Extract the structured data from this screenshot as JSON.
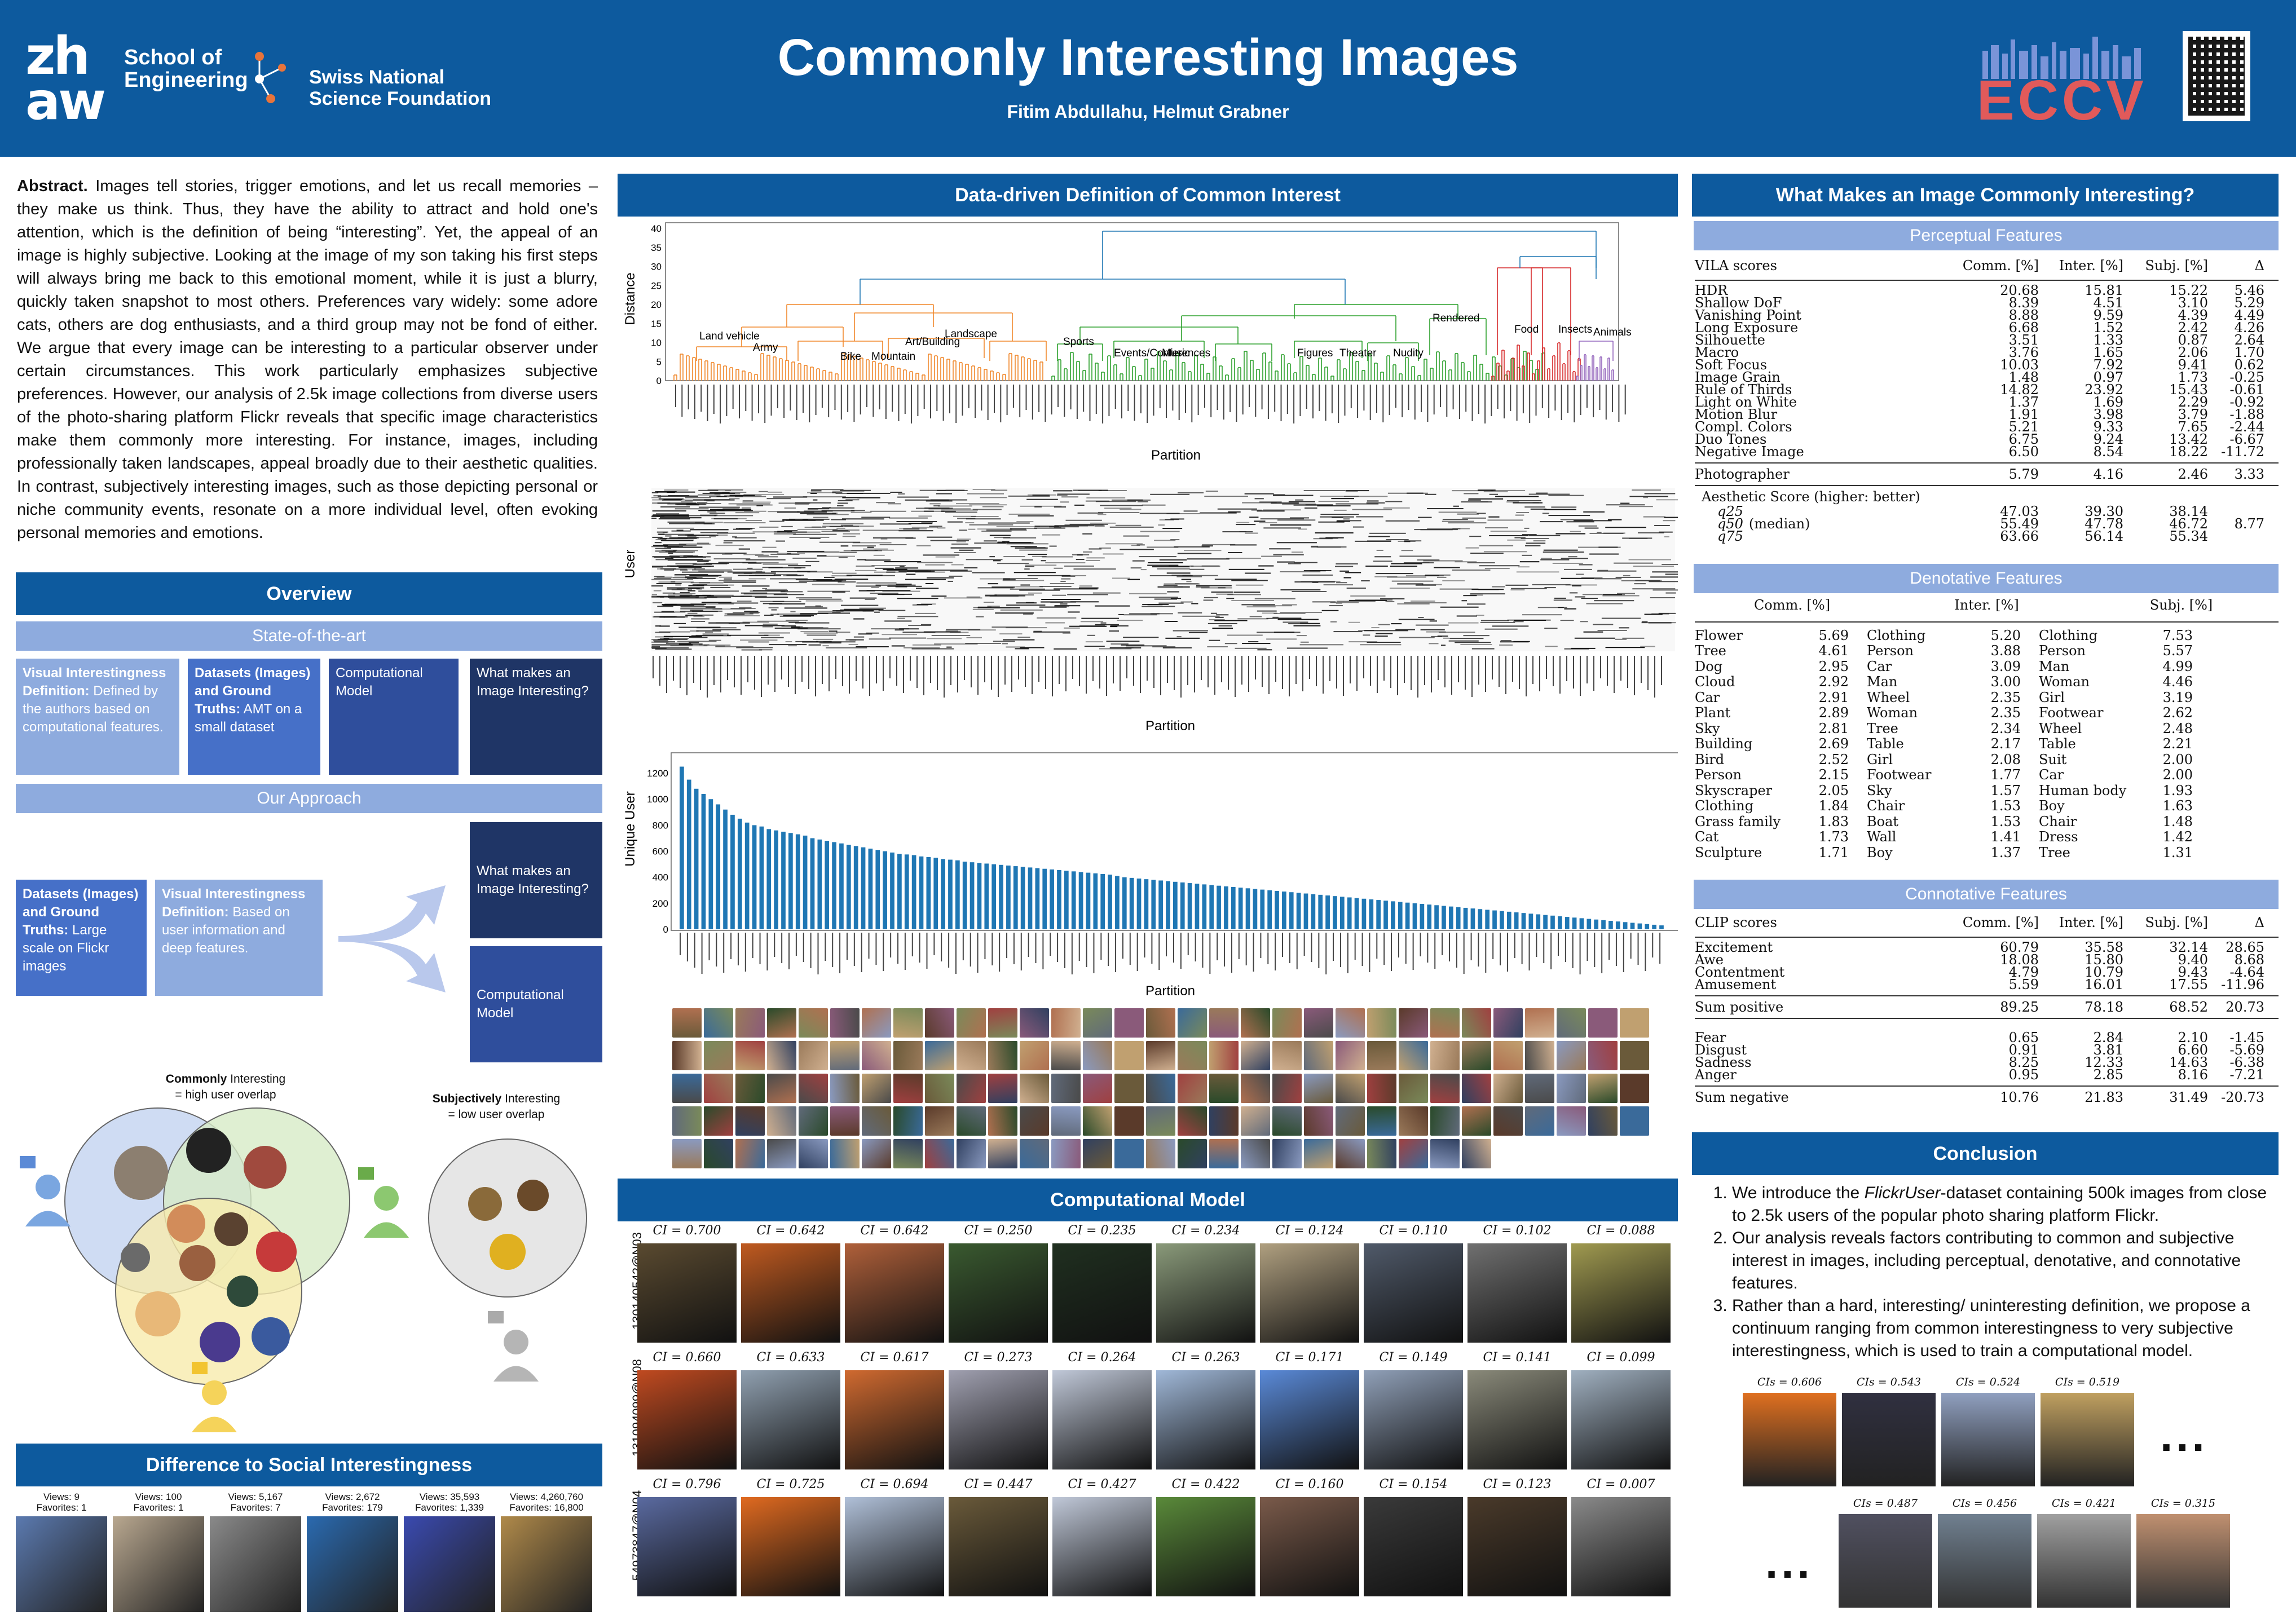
{
  "header": {
    "logo_zh": "zh",
    "logo_aw": "aw",
    "school": "School of Engineering",
    "school_line1": "School of",
    "school_line2": "Engineering",
    "snsf_line1": "Swiss National",
    "snsf_line2": "Science Foundation",
    "title": "Commonly Interesting Images",
    "authors": "Fitim Abdullahu, Helmut Grabner",
    "eccv": "ECCV"
  },
  "abstract": {
    "label": "Abstract.",
    "text": "Images tell stories, trigger emotions, and let us recall memories – they make us think. Thus, they have the ability to attract and hold one's attention, which is the definition of being “interesting”. Yet, the appeal of an image is highly subjective. Looking at the image of my son taking his first steps will always bring me back to this emotional moment, while it is just a blurry, quickly taken snapshot to most others. Preferences vary widely: some adore cats, others are dog enthusiasts, and a third group may not be fond of either. We argue that every image can be interesting to a particular observer under certain circumstances. This work particularly emphasizes subjective preferences. However, our analysis of 2.5k image collections from diverse users of the photo-sharing platform Flickr reveals that specific image characteristics make them commonly more interesting. For instance, images, including professionally taken landscapes, appeal broadly due to their aesthetic qualities. In contrast, subjectively interesting images, such as those depicting personal or niche community events, resonate on a more individual level, often evoking personal memories and emotions."
  },
  "overview": {
    "title": "Overview",
    "sota": "State-of-the-art",
    "sota_boxes": [
      {
        "bold": "Visual Interestingness Definition:",
        "rest": " Defined by the authors based on computational features."
      },
      {
        "bold": "Datasets (Images) and Ground Truths:",
        "rest": " AMT on a small dataset"
      },
      {
        "bold": "",
        "rest": "Computational Model"
      },
      {
        "bold": "",
        "rest": "What makes an Image Interesting?"
      }
    ],
    "approach": "Our Approach",
    "approach_boxes": [
      {
        "bold": "Datasets (Images) and Ground Truths:",
        "rest": " Large scale on Flickr images"
      },
      {
        "bold": "Visual Interestingness Definition:",
        "rest": " Based on user information and deep features."
      },
      {
        "bold": "",
        "rest": "What makes an Image Interesting?"
      },
      {
        "bold": "",
        "rest": "Computational Model"
      }
    ],
    "commonly_bold": "Commonly",
    "commonly_rest": " Interesting",
    "commonly_sub": "= high user overlap",
    "subj_bold": "Subjectively",
    "subj_rest": " Interesting",
    "subj_sub": "= low user overlap"
  },
  "social": {
    "title": "Difference to Social Interestingness",
    "items": [
      {
        "views": "Views: 9",
        "fav": "Favorites: 1"
      },
      {
        "views": "Views: 100",
        "fav": "Favorites: 1"
      },
      {
        "views": "Views: 5,167",
        "fav": "Favorites: 7"
      },
      {
        "views": "Views: 2,672",
        "fav": "Favorites: 179"
      },
      {
        "views": "Views: 35,593",
        "fav": "Favorites: 1,339"
      },
      {
        "views": "Views: 4,260,760",
        "fav": "Favorites: 16,800"
      }
    ]
  },
  "datadriven": {
    "title": "Data-driven Definition of Common Interest",
    "dendro_ylabel": "Distance",
    "dendro_xlabel": "Partition",
    "dendro_yticks": [
      "0",
      "5",
      "10",
      "15",
      "20",
      "25",
      "30",
      "35",
      "40"
    ],
    "clusters": [
      "Land vehicle",
      "Army",
      "Bike",
      "Mountain",
      "Art/Building",
      "Landscape",
      "Sports",
      "Events/Conferences",
      "Music",
      "Figures",
      "Theater",
      "Nudity",
      "Rendered",
      "Food",
      "Insects",
      "Animals"
    ],
    "user_ylabel": "User",
    "user_xlabel": "Partition",
    "bar_ylabel": "Unique User",
    "bar_xlabel": "Partition",
    "bar_yticks": [
      "0",
      "200",
      "400",
      "600",
      "800",
      "1000",
      "1200"
    ]
  },
  "chart_data": {
    "type": "bar",
    "title": "",
    "xlabel": "Partition",
    "ylabel": "Unique User",
    "ylim": [
      0,
      1300
    ],
    "values": [
      1250,
      1150,
      1080,
      1040,
      1000,
      960,
      920,
      880,
      850,
      820,
      800,
      790,
      770,
      760,
      750,
      740,
      730,
      720,
      700,
      690,
      680,
      670,
      660,
      650,
      640,
      630,
      620,
      610,
      600,
      590,
      580,
      575,
      570,
      560,
      555,
      550,
      540,
      535,
      530,
      520,
      515,
      510,
      505,
      500,
      495,
      490,
      485,
      480,
      475,
      470,
      465,
      460,
      455,
      450,
      445,
      440,
      435,
      430,
      425,
      420,
      410,
      400,
      395,
      390,
      385,
      380,
      375,
      370,
      365,
      360,
      355,
      350,
      345,
      340,
      335,
      330,
      325,
      320,
      315,
      310,
      305,
      300,
      295,
      290,
      285,
      280,
      275,
      270,
      265,
      260,
      255,
      250,
      245,
      240,
      235,
      230,
      225,
      220,
      215,
      210,
      205,
      200,
      195,
      190,
      185,
      180,
      175,
      170,
      165,
      160,
      155,
      150,
      145,
      140,
      135,
      130,
      125,
      120,
      115,
      110,
      105,
      100,
      95,
      90,
      85,
      80,
      75,
      70,
      65,
      60,
      55,
      50,
      45,
      40,
      35,
      30
    ]
  },
  "compmodel": {
    "title": "Computational Model",
    "rows": [
      {
        "user": "130140542@N03",
        "ci": [
          "CI = 0.700",
          "CI = 0.642",
          "CI = 0.642",
          "CI = 0.250",
          "CI = 0.235",
          "CI = 0.234",
          "CI = 0.124",
          "CI = 0.110",
          "CI = 0.102",
          "CI = 0.088"
        ]
      },
      {
        "user": "131094099@N08",
        "ci": [
          "CI = 0.660",
          "CI = 0.633",
          "CI = 0.617",
          "CI = 0.273",
          "CI = 0.264",
          "CI = 0.263",
          "CI = 0.171",
          "CI = 0.149",
          "CI = 0.141",
          "CI = 0.099"
        ]
      },
      {
        "user": "54973847@N04",
        "ci": [
          "CI = 0.796",
          "CI = 0.725",
          "CI = 0.694",
          "CI = 0.447",
          "CI = 0.427",
          "CI = 0.422",
          "CI = 0.160",
          "CI = 0.154",
          "CI = 0.123",
          "CI = 0.007"
        ]
      }
    ]
  },
  "what": {
    "title": "What Makes an Image Commonly Interesting?",
    "perceptual": "Perceptual Features",
    "vila_header": [
      "VILA scores",
      "Comm. [%]",
      "Inter. [%]",
      "Subj. [%]",
      "Δ"
    ],
    "vila_rows": [
      [
        "HDR",
        "20.68",
        "15.81",
        "15.22",
        "5.46"
      ],
      [
        "Shallow DoF",
        "8.39",
        "4.51",
        "3.10",
        "5.29"
      ],
      [
        "Vanishing Point",
        "8.88",
        "9.59",
        "4.39",
        "4.49"
      ],
      [
        "Long Exposure",
        "6.68",
        "1.52",
        "2.42",
        "4.26"
      ],
      [
        "Silhouette",
        "3.51",
        "1.33",
        "0.87",
        "2.64"
      ],
      [
        "Macro",
        "3.76",
        "1.65",
        "2.06",
        "1.70"
      ],
      [
        "Soft Focus",
        "10.03",
        "7.92",
        "9.41",
        "0.62"
      ],
      [
        "Image Grain",
        "1.48",
        "0.97",
        "1.73",
        "-0.25"
      ],
      [
        "Rule of Thirds",
        "14.82",
        "23.92",
        "15.43",
        "-0.61"
      ],
      [
        "Light on White",
        "1.37",
        "1.69",
        "2.29",
        "-0.92"
      ],
      [
        "Motion Blur",
        "1.91",
        "3.98",
        "3.79",
        "-1.88"
      ],
      [
        "Compl. Colors",
        "5.21",
        "9.33",
        "7.65",
        "-2.44"
      ],
      [
        "Duo Tones",
        "6.75",
        "9.24",
        "13.42",
        "-6.67"
      ],
      [
        "Negative Image",
        "6.50",
        "8.54",
        "18.22",
        "-11.72"
      ]
    ],
    "photographer": [
      "Photographer",
      "5.79",
      "4.16",
      "2.46",
      "3.33"
    ],
    "aesthetic_label": "Aesthetic Score (higher: better)",
    "aesthetic_rows": [
      [
        "q25",
        "",
        "47.03",
        "39.30",
        "38.14"
      ],
      [
        "q50",
        "(median)",
        "55.49",
        "47.78",
        "46.72"
      ],
      [
        "q75",
        "",
        "63.66",
        "56.14",
        "55.34"
      ]
    ],
    "aesthetic_delta": "8.77",
    "denotative": "Denotative Features",
    "den_header": [
      "Comm. [%]",
      "Inter. [%]",
      "Subj. [%]"
    ],
    "den_comm": [
      [
        "Flower",
        "5.69"
      ],
      [
        "Tree",
        "4.61"
      ],
      [
        "Dog",
        "2.95"
      ],
      [
        "Cloud",
        "2.92"
      ],
      [
        "Car",
        "2.91"
      ],
      [
        "Plant",
        "2.89"
      ],
      [
        "Sky",
        "2.81"
      ],
      [
        "Building",
        "2.69"
      ],
      [
        "Bird",
        "2.52"
      ],
      [
        "Person",
        "2.15"
      ],
      [
        "Skyscraper",
        "2.05"
      ],
      [
        "Clothing",
        "1.84"
      ],
      [
        "Grass family",
        "1.83"
      ],
      [
        "Cat",
        "1.73"
      ],
      [
        "Sculpture",
        "1.71"
      ]
    ],
    "den_inter": [
      [
        "Clothing",
        "5.20"
      ],
      [
        "Person",
        "3.88"
      ],
      [
        "Car",
        "3.09"
      ],
      [
        "Man",
        "3.00"
      ],
      [
        "Wheel",
        "2.35"
      ],
      [
        "Woman",
        "2.35"
      ],
      [
        "Tree",
        "2.34"
      ],
      [
        "Table",
        "2.17"
      ],
      [
        "Girl",
        "2.08"
      ],
      [
        "Footwear",
        "1.77"
      ],
      [
        "Sky",
        "1.57"
      ],
      [
        "Chair",
        "1.53"
      ],
      [
        "Boat",
        "1.53"
      ],
      [
        "Wall",
        "1.41"
      ],
      [
        "Boy",
        "1.37"
      ]
    ],
    "den_subj": [
      [
        "Clothing",
        "7.53"
      ],
      [
        "Person",
        "5.57"
      ],
      [
        "Man",
        "4.99"
      ],
      [
        "Woman",
        "4.46"
      ],
      [
        "Girl",
        "3.19"
      ],
      [
        "Footwear",
        "2.62"
      ],
      [
        "Wheel",
        "2.48"
      ],
      [
        "Table",
        "2.21"
      ],
      [
        "Suit",
        "2.00"
      ],
      [
        "Car",
        "2.00"
      ],
      [
        "Human body",
        "1.93"
      ],
      [
        "Boy",
        "1.63"
      ],
      [
        "Chair",
        "1.48"
      ],
      [
        "Dress",
        "1.42"
      ],
      [
        "Tree",
        "1.31"
      ]
    ],
    "connotative": "Connotative Features",
    "clip_header": [
      "CLIP scores",
      "Comm. [%]",
      "Inter. [%]",
      "Subj. [%]",
      "Δ"
    ],
    "clip_pos": [
      [
        "Excitement",
        "60.79",
        "35.58",
        "32.14",
        "28.65"
      ],
      [
        "Awe",
        "18.08",
        "15.80",
        "9.40",
        "8.68"
      ],
      [
        "Contentment",
        "4.79",
        "10.79",
        "9.43",
        "-4.64"
      ],
      [
        "Amusement",
        "5.59",
        "16.01",
        "17.55",
        "-11.96"
      ]
    ],
    "sum_pos": [
      "Sum positive",
      "89.25",
      "78.18",
      "68.52",
      "20.73"
    ],
    "clip_neg": [
      [
        "Fear",
        "0.65",
        "2.84",
        "2.10",
        "-1.45"
      ],
      [
        "Disgust",
        "0.91",
        "3.81",
        "6.60",
        "-5.69"
      ],
      [
        "Sadness",
        "8.25",
        "12.33",
        "14.63",
        "-6.38"
      ],
      [
        "Anger",
        "0.95",
        "2.85",
        "8.16",
        "-7.21"
      ]
    ],
    "sum_neg": [
      "Sum negative",
      "10.76",
      "21.83",
      "31.49",
      "-20.73"
    ]
  },
  "conclusion": {
    "title": "Conclusion",
    "items": [
      {
        "pre": "We introduce the ",
        "em": "FlickrUser",
        "post": "-dataset containing 500k images from close to 2.5k users of the popular photo sharing platform Flickr."
      },
      {
        "pre": "Our analysis reveals factors contributing to common and subjective interest in images, including perceptual, denotative, and connotative features.",
        "em": "",
        "post": ""
      },
      {
        "pre": "Rather than a hard, interesting/ uninteresting definition, we propose a continuum ranging from common interestingness to very subjective interestingness, which is used to train a computational model.",
        "em": "",
        "post": ""
      }
    ],
    "row1": [
      "CIs = 0.606",
      "CIs = 0.543",
      "CIs = 0.524",
      "CIs = 0.519"
    ],
    "row2": [
      "CIs = 0.487",
      "CIs = 0.456",
      "CIs = 0.421",
      "CIs = 0.315"
    ],
    "ellipsis": "..."
  }
}
